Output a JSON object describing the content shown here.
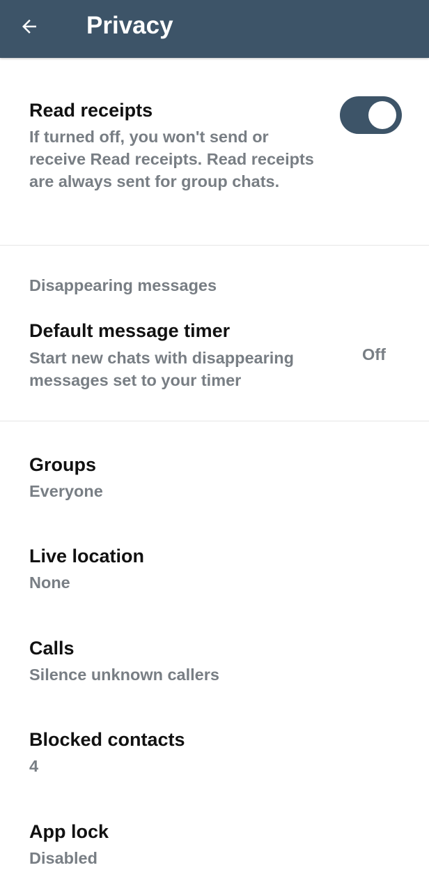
{
  "app_bar": {
    "title": "Privacy",
    "background": "#3d5468",
    "back_icon": "arrow-left-icon"
  },
  "read_receipts": {
    "title": "Read receipts",
    "description": "If turned off, you won't send or receive Read receipts. Read receipts are always sent for group chats.",
    "toggle_on": true
  },
  "disappearing": {
    "header": "Disappearing messages",
    "title": "Default message timer",
    "description": "Start new chats with disappearing messages set to your timer",
    "value": "Off"
  },
  "items": [
    {
      "title": "Groups",
      "value": "Everyone"
    },
    {
      "title": "Live location",
      "value": "None"
    },
    {
      "title": "Calls",
      "value": "Silence unknown callers"
    },
    {
      "title": "Blocked contacts",
      "value": "4"
    },
    {
      "title": "App lock",
      "value": "Disabled"
    }
  ],
  "colors": {
    "accent": "#3d5468",
    "title_text": "#111111",
    "secondary_text": "#787e84"
  }
}
